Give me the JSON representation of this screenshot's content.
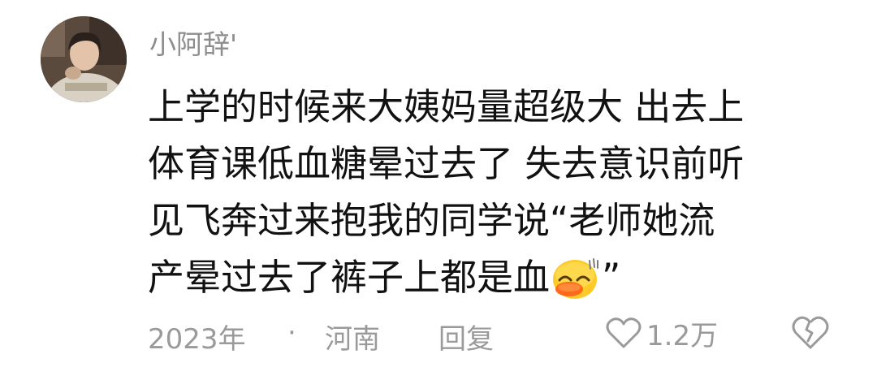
{
  "comment": {
    "username": "小阿辞'",
    "avatar_icon": "user-avatar-photo",
    "lines": [
      "上学的时候来大姨妈量超级大 出去上",
      "体育课低血糖晕过去了 失去意识前听",
      "见飞奔过来抱我的同学说“老师她流",
      "产晕过去了裤子上都是血"
    ],
    "closing_quote": "”",
    "emoji_icon": "sweat-laughing-duck-emoji"
  },
  "footer": {
    "year": "2023年",
    "separator": "·",
    "location": "河南",
    "reply_label": "回复",
    "like_icon": "heart-outline-icon",
    "like_count": "1.2万",
    "dislike_icon": "broken-heart-icon"
  },
  "colors": {
    "meta_gray": "#9a9a9a",
    "username_gray": "#8d8d8d",
    "text": "#111111"
  }
}
